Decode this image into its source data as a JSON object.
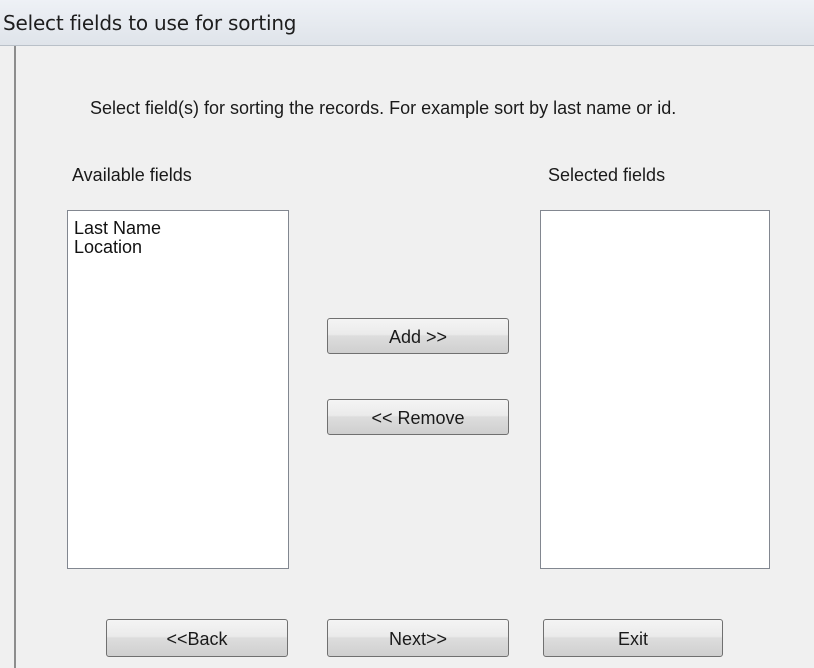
{
  "window": {
    "title": "Select fields to use for sorting"
  },
  "instructions": "Select field(s) for sorting the records. For example sort by last name or id.",
  "available": {
    "label": "Available fields",
    "items": [
      "Last Name",
      "Location"
    ]
  },
  "selected": {
    "label": "Selected fields",
    "items": []
  },
  "buttons": {
    "add": "Add >>",
    "remove": "<< Remove",
    "back": "<<Back",
    "next": "Next>>",
    "exit": "Exit"
  },
  "colors": {
    "window_bg": "#f0f0f0",
    "list_bg": "#ffffff",
    "list_border": "#828790",
    "button_border": "#707070"
  }
}
